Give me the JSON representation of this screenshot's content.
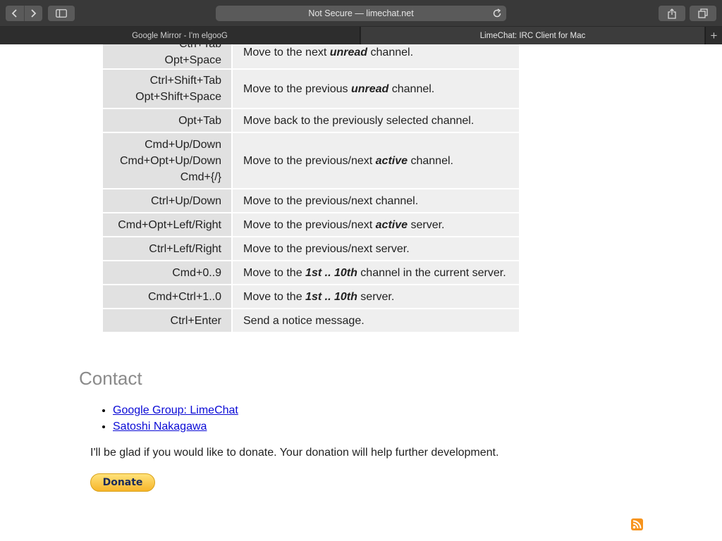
{
  "browser": {
    "address_text": "Not Secure — limechat.net",
    "tabs": [
      {
        "label": "Google Mirror - I'm elgooG"
      },
      {
        "label": "LimeChat: IRC Client for Mac"
      }
    ],
    "new_tab_label": "+"
  },
  "shortcuts": [
    {
      "keys": [
        "Ctrl+Tab",
        "Opt+Space"
      ],
      "desc_pre": "Move to the next ",
      "desc_em": "unread",
      "desc_post": " channel."
    },
    {
      "keys": [
        "Ctrl+Shift+Tab",
        "Opt+Shift+Space"
      ],
      "desc_pre": "Move to the previous ",
      "desc_em": "unread",
      "desc_post": " channel."
    },
    {
      "keys": [
        "Opt+Tab"
      ],
      "desc_pre": "Move back to the previously selected channel.",
      "desc_em": "",
      "desc_post": ""
    },
    {
      "keys": [
        "Cmd+Up/Down",
        "Cmd+Opt+Up/Down",
        "Cmd+{/}"
      ],
      "desc_pre": "Move to the previous/next ",
      "desc_em": "active",
      "desc_post": " channel."
    },
    {
      "keys": [
        "Ctrl+Up/Down"
      ],
      "desc_pre": "Move to the previous/next channel.",
      "desc_em": "",
      "desc_post": ""
    },
    {
      "keys": [
        "Cmd+Opt+Left/Right"
      ],
      "desc_pre": "Move to the previous/next ",
      "desc_em": "active",
      "desc_post": " server."
    },
    {
      "keys": [
        "Ctrl+Left/Right"
      ],
      "desc_pre": "Move to the previous/next server.",
      "desc_em": "",
      "desc_post": ""
    },
    {
      "keys": [
        "Cmd+0..9"
      ],
      "desc_pre": "Move to the ",
      "desc_em": "1st .. 10th",
      "desc_post": " channel in the current server."
    },
    {
      "keys": [
        "Cmd+Ctrl+1..0"
      ],
      "desc_pre": "Move to the ",
      "desc_em": "1st .. 10th",
      "desc_post": " server."
    },
    {
      "keys": [
        "Ctrl+Enter"
      ],
      "desc_pre": "Send a notice message.",
      "desc_em": "",
      "desc_post": ""
    }
  ],
  "contact": {
    "heading": "Contact",
    "links": [
      {
        "label": "Google Group: LimeChat"
      },
      {
        "label": "Satoshi Nakagawa"
      }
    ],
    "donate_text": "I'll be glad if you would like to donate. Your donation will help further development.",
    "donate_button": "Donate"
  },
  "colors": {
    "key_cell": "#e1e1e1",
    "desc_cell": "#efefef",
    "link": "#0a0ad6",
    "heading": "#8a8a8a",
    "rss": "#f7941d"
  }
}
